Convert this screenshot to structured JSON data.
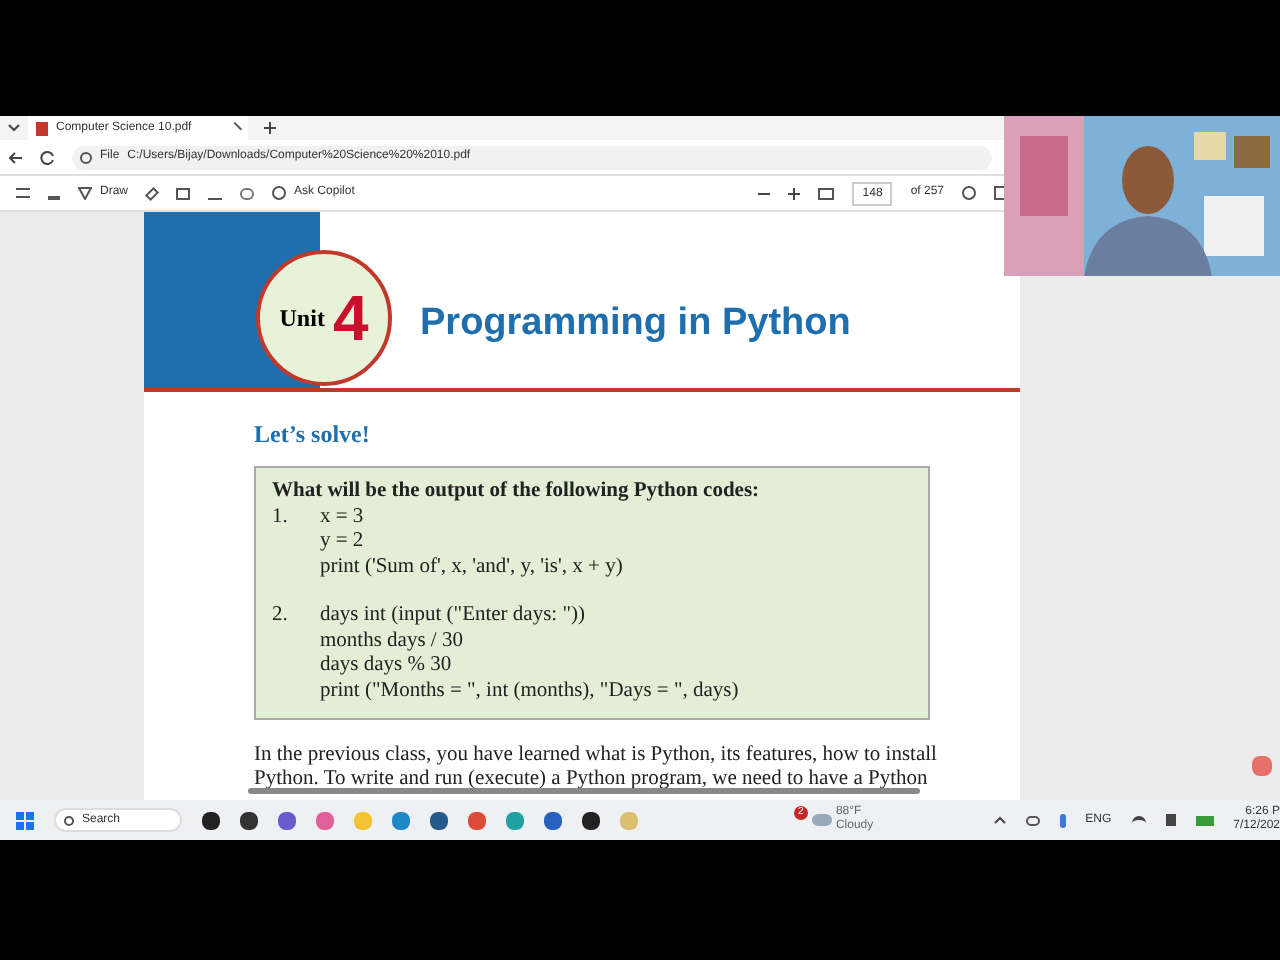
{
  "browser": {
    "tab": {
      "title": "Computer Science 10.pdf",
      "selected": true
    },
    "address": {
      "scheme": "File",
      "url": "C:/Users/Bijay/Downloads/Computer%20Science%20%2010.pdf"
    }
  },
  "toolbar": {
    "draw": "Draw",
    "copilot": "Ask Copilot",
    "page": "148",
    "page_count": "of 257"
  },
  "document": {
    "unit_label": "Unit",
    "unit_number": "4",
    "title": "Programming in Python",
    "section": "Let’s solve!",
    "exercise": {
      "question": "What will be the output of the following Python codes:",
      "items": [
        {
          "number": "1.",
          "lines": [
            "x = 3",
            "y = 2",
            "print ('Sum of', x, 'and', y, 'is', x + y)"
          ]
        },
        {
          "number": "2.",
          "lines": [
            "days int (input (\"Enter days: \"))",
            "months days / 30",
            "days days % 30",
            "print (\"Months = \", int (months), \"Days = \", days)"
          ]
        }
      ]
    },
    "paragraph_lines": [
      "In the previous class, you have learned what is Python, its features, how to install",
      "Python. To write and run (execute) a Python program, we need to have a Python"
    ]
  },
  "taskbar": {
    "search": "Search",
    "weather": {
      "temp": "88°F",
      "condition": "Cloudy",
      "badge": "2"
    },
    "language": "ENG",
    "time": "6:26 P",
    "date": "7/12/202"
  }
}
